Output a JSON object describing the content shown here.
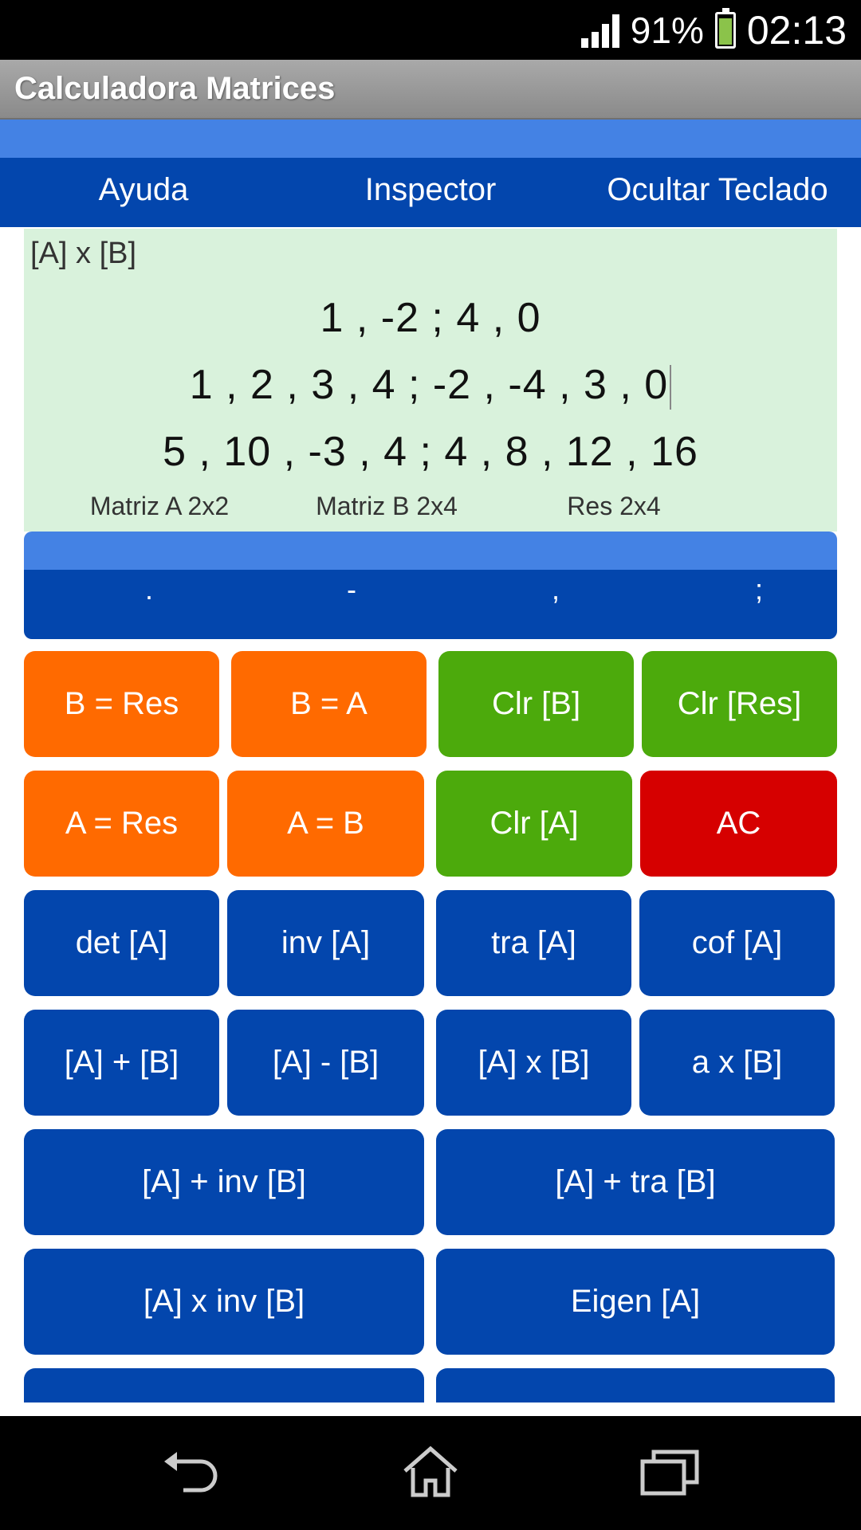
{
  "status": {
    "battery_percent": "91%",
    "time": "02:13",
    "battery_level": 0.91
  },
  "app": {
    "title": "Calculadora Matrices"
  },
  "menu": {
    "help": "Ayuda",
    "inspector": "Inspector",
    "hide_keyboard": "Ocultar Teclado"
  },
  "display": {
    "operation": "[A] x [B]",
    "matrix_a": "1 , -2 ; 4 , 0",
    "matrix_b": "1 , 2 , 3 , 4 ; -2 , -4 , 3 , 0",
    "result": "5 , 10 , -3 , 4 ; 4 , 8 , 12 , 16",
    "dim_a": "Matriz A 2x2",
    "dim_b": "Matriz B 2x4",
    "dim_res": "Res 2x4"
  },
  "keys": {
    "dot": ".",
    "minus": "-",
    "comma": ",",
    "semicolon": ";"
  },
  "buttons": {
    "b_eq_res": "B = Res",
    "b_eq_a": "B = A",
    "clr_b": "Clr [B]",
    "clr_res": "Clr [Res]",
    "a_eq_res": "A = Res",
    "a_eq_b": "A = B",
    "clr_a": "Clr [A]",
    "ac": "AC",
    "det_a": "det [A]",
    "inv_a": "inv [A]",
    "tra_a": "tra [A]",
    "cof_a": "cof [A]",
    "a_plus_b": "[A] + [B]",
    "a_minus_b": "[A] - [B]",
    "a_times_b": "[A] x [B]",
    "scalar_times_b": "a x [B]",
    "a_plus_inv_b": "[A] + inv [B]",
    "a_plus_tra_b": "[A] + tra [B]",
    "a_times_inv_b": "[A] x inv [B]",
    "eigen_a": "Eigen [A]"
  },
  "colors": {
    "orange": "#ff6a00",
    "green": "#4caa0c",
    "red": "#d60000",
    "blue": "#0346ad",
    "light_blue": "#4482e4",
    "display_bg": "#d9f2dc"
  }
}
